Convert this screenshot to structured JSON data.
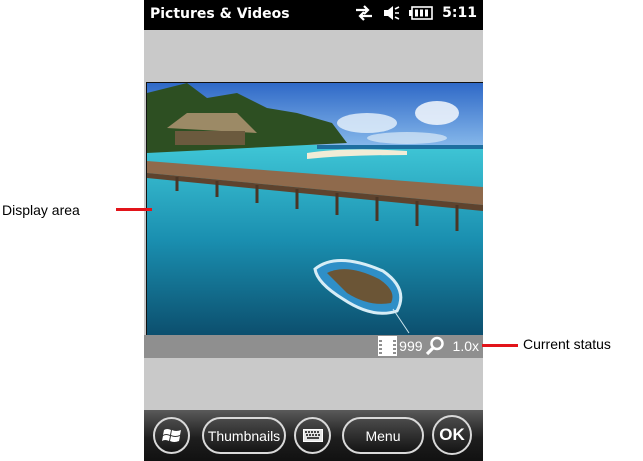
{
  "window": {
    "title": "Pictures & Videos",
    "clock": "5:11"
  },
  "status_icons": [
    "sync-icon",
    "speaker-icon",
    "battery-icon"
  ],
  "status": {
    "frame_count": "999",
    "zoom": "1.0x"
  },
  "softkeys": {
    "start_icon": "windows-flag-icon",
    "thumbnails_label": "Thumbnails",
    "keyboard_icon": "keyboard-icon",
    "menu_label": "Menu",
    "ok_label": "OK"
  },
  "annotations": {
    "display_area": "Display area",
    "current_status": "Current status"
  },
  "colors": {
    "callout": "#e2141a",
    "screen_bg": "#c9c9c9",
    "status_bar": "#8f8f8f"
  }
}
